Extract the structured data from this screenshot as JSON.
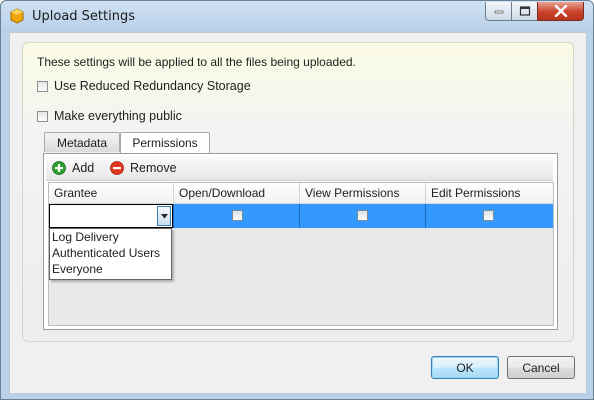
{
  "window": {
    "title": "Upload Settings",
    "colors": {
      "selection": "#3399ff",
      "close_button": "#c9432a"
    }
  },
  "info_text": "These settings will be applied to all the files being uploaded.",
  "options": {
    "reduced_redundancy": {
      "label": "Use Reduced Redundancy Storage",
      "checked": false
    },
    "make_public": {
      "label": "Make everything public",
      "checked": false
    }
  },
  "tabs": [
    {
      "label": "Metadata",
      "selected": false
    },
    {
      "label": "Permissions",
      "selected": true
    }
  ],
  "toolbar": {
    "add_label": "Add",
    "add_icon": "add-icon",
    "remove_label": "Remove",
    "remove_icon": "remove-icon"
  },
  "grid": {
    "columns": [
      "Grantee",
      "Open/Download",
      "View Permissions",
      "Edit Permissions"
    ],
    "rows": [
      {
        "grantee": "",
        "open_download": false,
        "view_permissions": false,
        "edit_permissions": false
      }
    ]
  },
  "grantee_dropdown": {
    "options": [
      "Log Delivery",
      "Authenticated Users",
      "Everyone"
    ]
  },
  "footer": {
    "ok_label": "OK",
    "cancel_label": "Cancel"
  }
}
